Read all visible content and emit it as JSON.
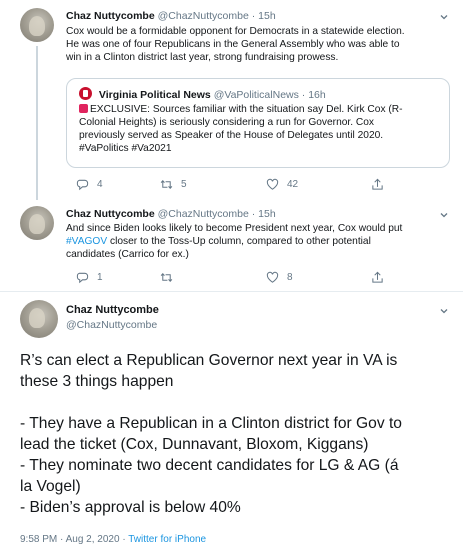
{
  "tweet1": {
    "name": "Chaz Nuttycombe",
    "handle": "@ChazNuttycombe",
    "time": "15h",
    "text_lines": [
      "Cox would be a formidable opponent for Democrats in a statewide election.",
      "He was one of four Republicans in the General Assembly who was able to",
      "win in a Clinton district last year, strong fundraising prowess."
    ],
    "quote": {
      "name": "Virginia Political News",
      "handle": "@VaPoliticalNews",
      "time": "16h",
      "text_lines": [
        "EXCLUSIVE: Sources familiar with the situation say Del. Kirk Cox (R-",
        "Colonial Heights) is seriously considering a run for Governor. Cox",
        "previously served as Speaker of the House of Delegates until 2020.",
        "#VaPolitics #Va2021"
      ]
    },
    "replies": "4",
    "retweets": "5",
    "likes": "42"
  },
  "tweet2": {
    "name": "Chaz Nuttycombe",
    "handle": "@ChazNuttycombe",
    "time": "15h",
    "line1": "And since Biden looks likely to become President next year, Cox would put",
    "line2_hashtag": "#VAGOV",
    "line2_rest": " closer to the Toss-Up column, compared to other potential",
    "line3": "candidates (Carrico for ex.)",
    "replies": "1",
    "retweets": "",
    "likes": "8"
  },
  "main": {
    "name": "Chaz Nuttycombe",
    "handle": "@ChazNuttycombe",
    "lines": [
      "R’s can elect a Republican Governor next year in VA is",
      "these 3 things happen",
      "",
      "- They have a Republican in a Clinton district for Gov to",
      "lead the ticket (Cox, Dunnavant, Bloxom, Kiggans)",
      "- They nominate two decent candidates for LG & AG (á",
      "la Vogel)",
      "- Biden’s approval is below 40%"
    ],
    "time": "9:58 PM",
    "date": "Aug 2, 2020",
    "source": "Twitter for iPhone"
  },
  "icons": {
    "reply": "reply-icon",
    "retweet": "retweet-icon",
    "like": "heart-icon",
    "share": "share-icon",
    "more": "chevron-down-icon"
  },
  "colors": {
    "link": "#1b95e0",
    "text": "#14171a",
    "muted": "#657786",
    "border": "#ccd6dd"
  }
}
